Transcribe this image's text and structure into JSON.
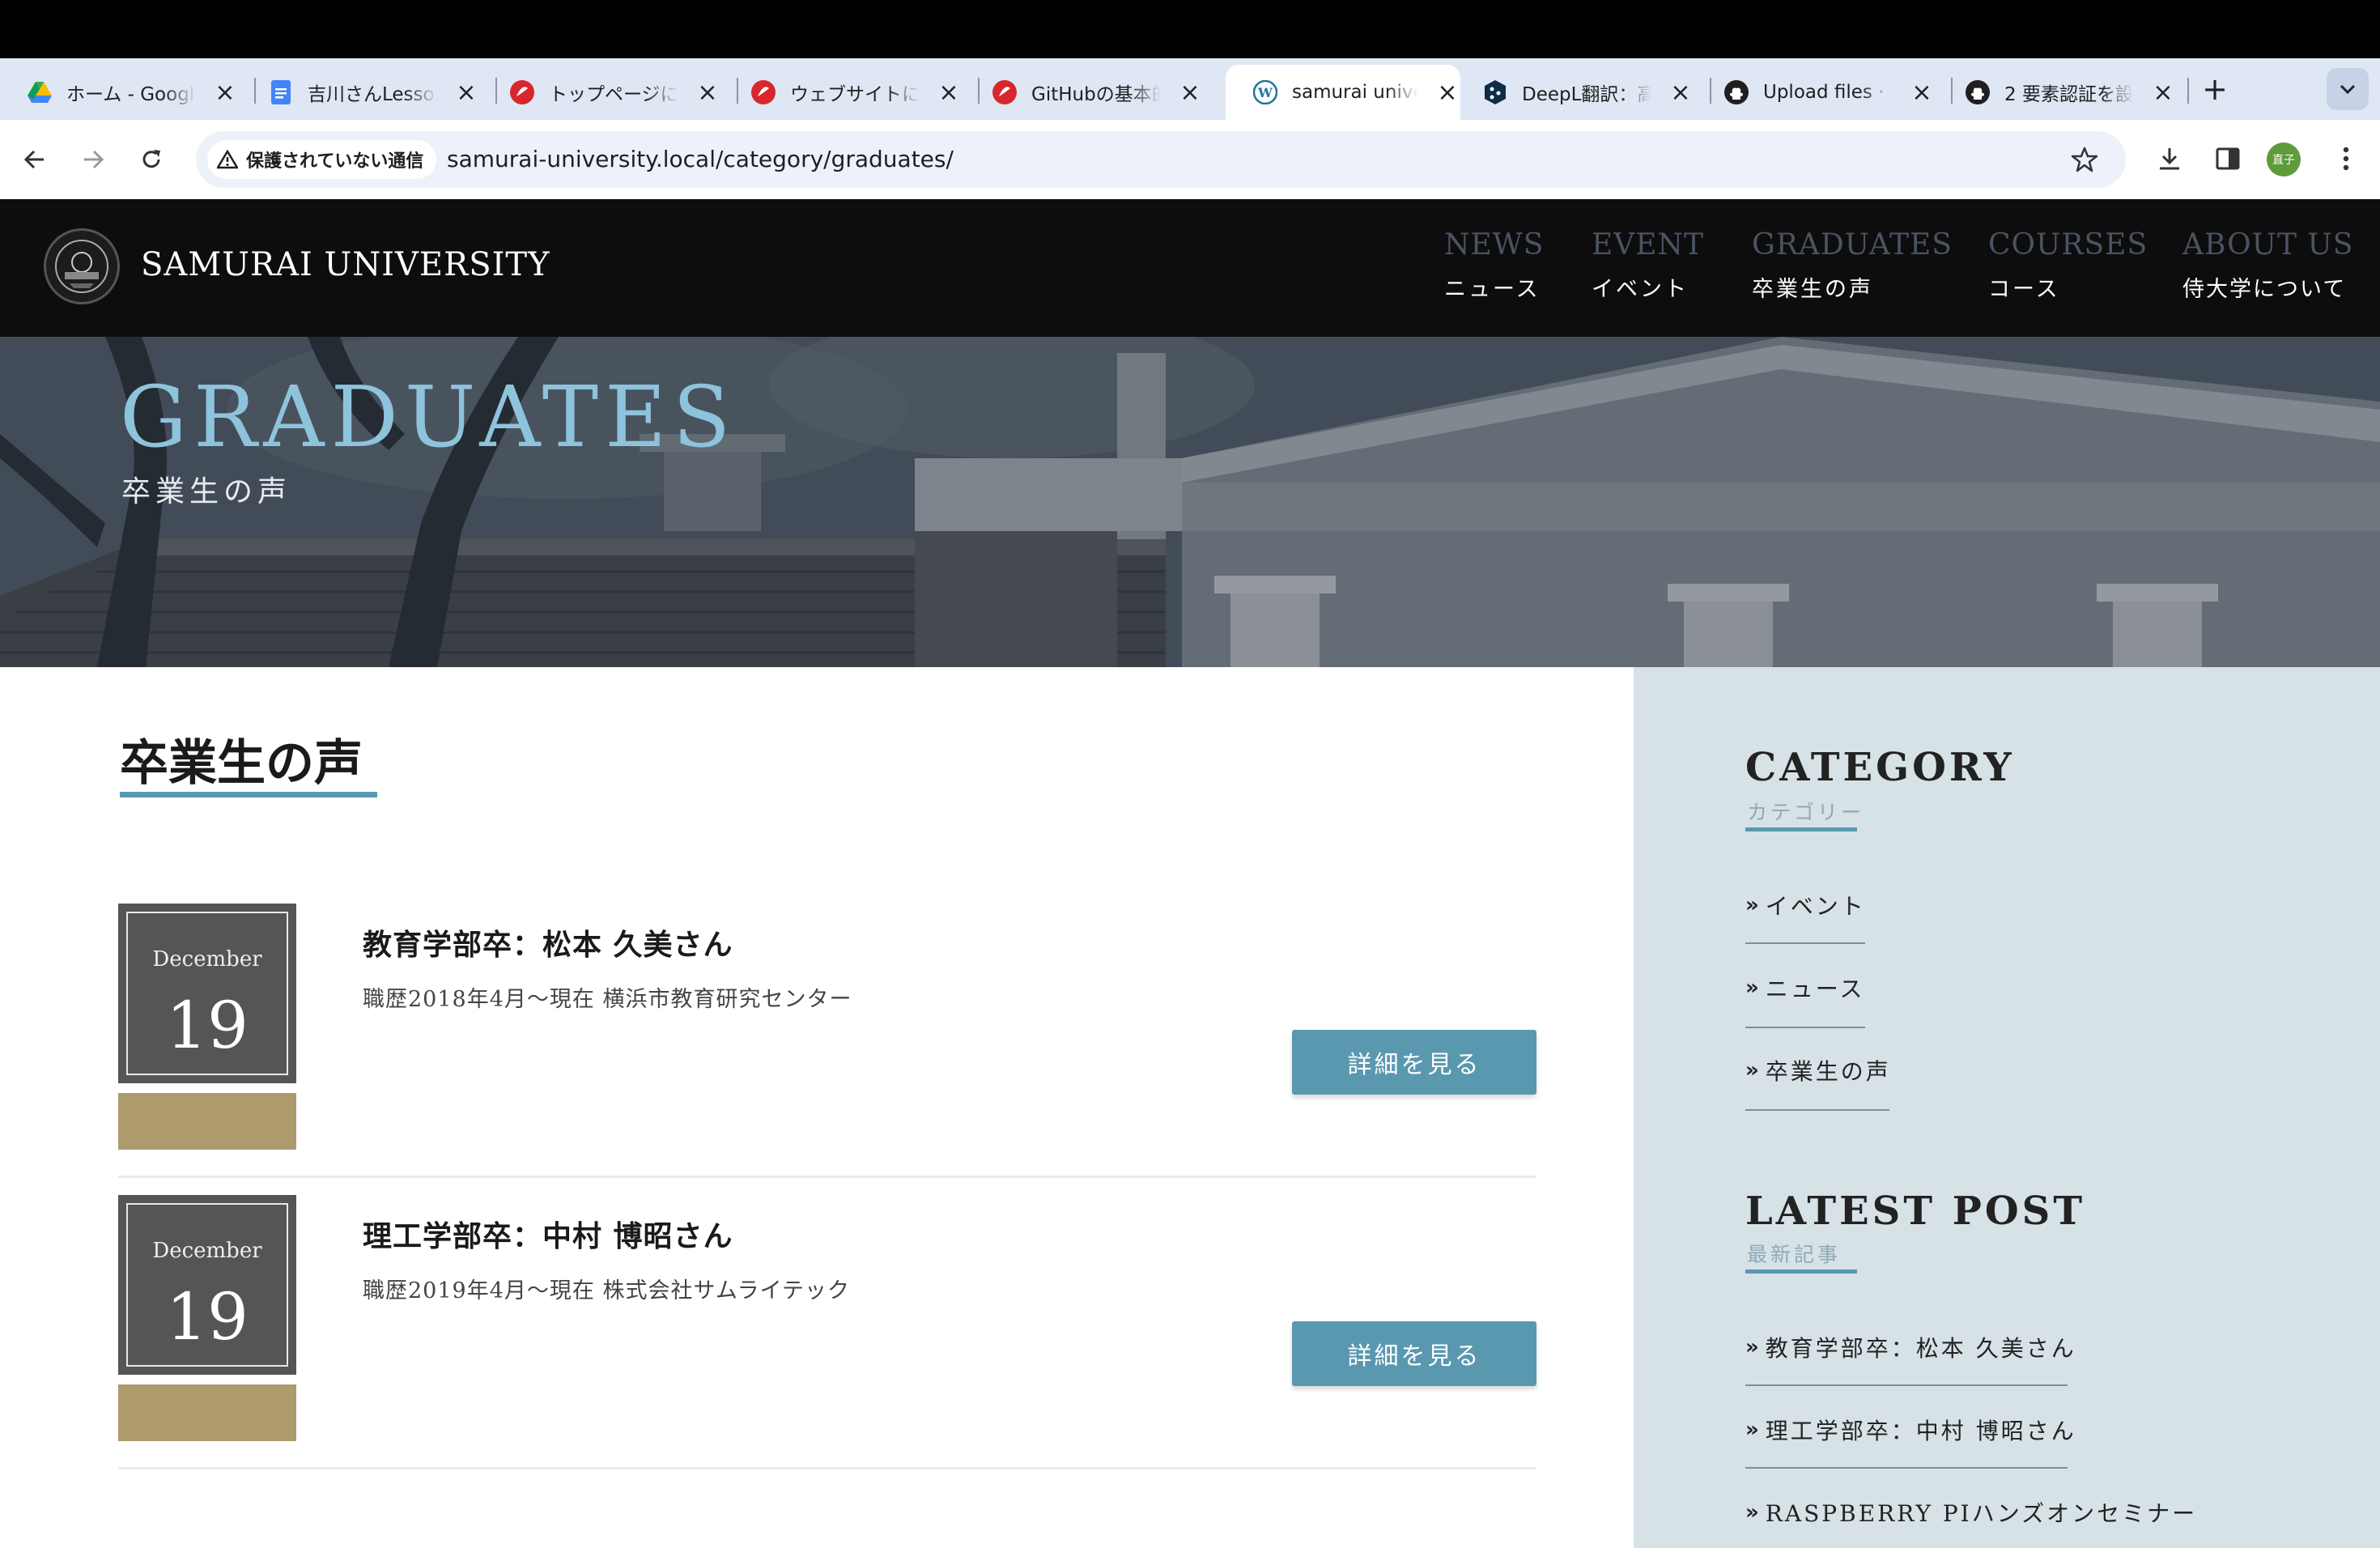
{
  "browser": {
    "tabs": [
      {
        "title": "ホーム - Google",
        "icon": "google-drive-icon"
      },
      {
        "title": "吉川さんLesson",
        "icon": "google-docs-icon"
      },
      {
        "title": "トップページに",
        "icon": "samurai-icon"
      },
      {
        "title": "ウェブサイトに",
        "icon": "samurai-icon"
      },
      {
        "title": "GitHubの基本的",
        "icon": "samurai-icon"
      },
      {
        "title": "samurai univer",
        "icon": "wordpress-icon",
        "active": true
      },
      {
        "title": "DeepL翻訳：高",
        "icon": "deepl-icon"
      },
      {
        "title": "Upload files ·",
        "icon": "github-icon"
      },
      {
        "title": "2 要素認証を設",
        "icon": "github-icon"
      }
    ],
    "new_tab_label": "+",
    "security_label": "保護されていない通信",
    "url": "samurai-university.local/category/graduates/",
    "profile_label": "直子"
  },
  "site": {
    "title": "SAMURAI UNIVERSITY",
    "nav": [
      {
        "en": "NEWS",
        "ja": "ニュース"
      },
      {
        "en": "EVENT",
        "ja": "イベント"
      },
      {
        "en": "GRADUATES",
        "ja": "卒業生の声"
      },
      {
        "en": "COURSES",
        "ja": "コース"
      },
      {
        "en": "ABOUT US",
        "ja": "侍大学について"
      }
    ]
  },
  "hero": {
    "title": "GRADUATES",
    "subtitle": "卒業生の声"
  },
  "main": {
    "heading": "卒業生の声",
    "posts": [
      {
        "month": "December",
        "day": "19",
        "title": "教育学部卒：松本 久美さん",
        "excerpt": "職歴2018年4月〜現在 横浜市教育研究センター",
        "button": "詳細を見る"
      },
      {
        "month": "December",
        "day": "19",
        "title": "理工学部卒：中村 博昭さん",
        "excerpt": "職歴2019年4月〜現在 株式会社サムライテック",
        "button": "詳細を見る"
      }
    ]
  },
  "sidebar": {
    "category": {
      "heading": "CATEGORY",
      "sub": "カテゴリー",
      "items": [
        "イベント",
        "ニュース",
        "卒業生の声"
      ]
    },
    "latest": {
      "heading": "LATEST POST",
      "sub": "最新記事",
      "items": [
        "教育学部卒：松本 久美さん",
        "理工学部卒：中村 博昭さん",
        "RASPBERRY PIハンズオンセミナー"
      ]
    }
  },
  "colors": {
    "accent": "#5a98b0",
    "hero_title": "#8ec3dc",
    "date_tag": "#ad9b6e",
    "sidebar_bg": "#d7e2e7",
    "header_bg": "#0d0d0d"
  }
}
